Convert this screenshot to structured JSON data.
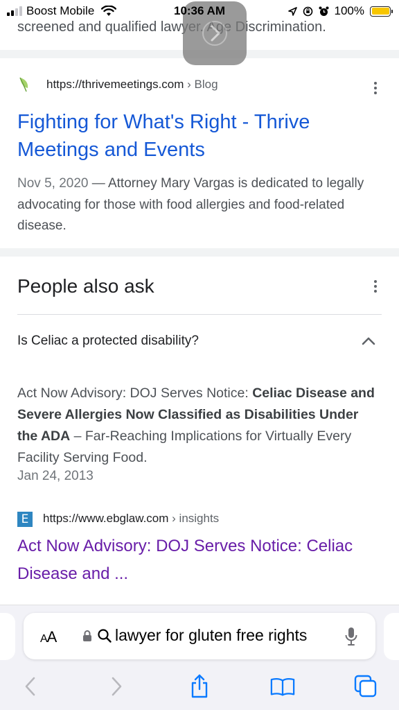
{
  "status_bar": {
    "carrier": "Boost Mobile",
    "time": "10:36 AM",
    "battery_percent": "100%",
    "battery_level": 1.0,
    "signal_bars_active": 2,
    "colors": {
      "battery": "#f7c600"
    }
  },
  "top_snippet": "screened and qualified lawyer. Age Discrimination.",
  "result1": {
    "favicon": "thrive-leaf-icon",
    "url": "https://thrivemeetings.com",
    "breadcrumb": "› Blog",
    "title": "Fighting for What's Right - Thrive Meetings and Events",
    "date": "Nov 5, 2020",
    "snippet": " — Attorney Mary Vargas is dedicated to legally advocating for those with food allergies and food-related disease."
  },
  "people_also_ask": {
    "heading": "People also ask",
    "question": "Is Celiac a protected disability?",
    "answer": {
      "prefix": "Act Now Advisory: DOJ Serves Notice: ",
      "bold": "Celiac Disease and Severe Allergies Now Classified as Disabilities Under the ADA",
      "suffix": " – Far-Reaching Implications for Virtually Every Facility Serving Food.",
      "date": "Jan 24, 2013"
    },
    "source": {
      "favicon_letter": "E",
      "url": "https://www.ebglaw.com",
      "breadcrumb": "› insights",
      "title": "Act Now Advisory: DOJ Serves Notice: Celiac Disease and ..."
    }
  },
  "browser": {
    "text_size_label_small": "A",
    "text_size_label_large": "A",
    "address_text": "lawyer for gluten free rights",
    "icons": {
      "lock": "lock-icon",
      "search": "search-icon",
      "mic": "microphone-icon",
      "back": "back-icon",
      "forward": "forward-icon",
      "share": "share-icon",
      "bookmarks": "bookmarks-icon",
      "tabs": "tabs-icon"
    },
    "colors": {
      "accent": "#0a7aff",
      "disabled": "#b8b8bd"
    }
  }
}
